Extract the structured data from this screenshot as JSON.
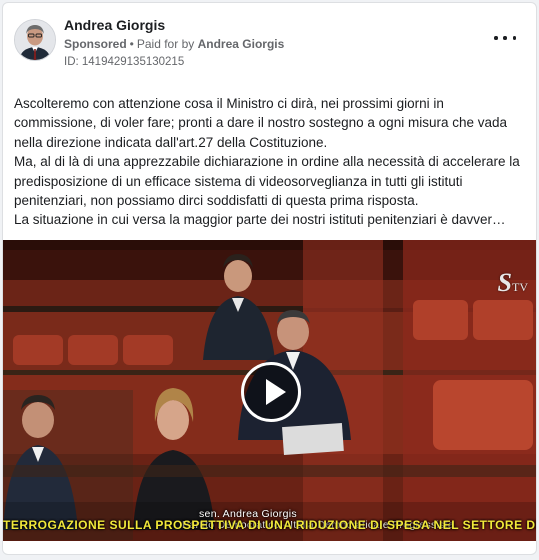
{
  "post": {
    "author": "Andrea Giorgis",
    "sponsored_label": "Sponsored",
    "paid_for_prefix": "Paid for by",
    "paid_for_by": "Andrea Giorgis",
    "ad_id": "ID: 1419429135130215",
    "paragraphs": [
      "Ascolteremo con attenzione cosa il Ministro ci dirà, nei prossimi giorni in commissione, di voler fare; pronti a dare il nostro sostegno a ogni misura che vada nella direzione indicata dall'art.27 della Costituzione.",
      "Ma, al di là di una apprezzabile dichiarazione in ordine alla necessità di accelerare la predisposizione di un efficace sistema di videosorveglianza in tutti gli istituti penitenziari, non possiamo dirci soddisfatti di questa prima risposta.",
      "La situazione in cui versa la maggior parte dei nostri istituti penitenziari è davver…"
    ]
  },
  "video": {
    "channel_logo_letter": "S",
    "channel_logo_suffix": "TV",
    "caption_name": "sen. Andrea Giorgis",
    "caption_party": "Partito Democratico - Italia Democratica e Progressista",
    "ticker": "TERROGAZIONE SULLA PROSPETTIVA DI UNA RIDUZIONE DI SPESA NEL SETTORE DE"
  },
  "icons": {
    "more": "more-horizontal-icon",
    "play": "play-icon"
  },
  "colors": {
    "ticker": "#f2e93a",
    "secondary_text": "#65676b",
    "chamber_red": "#8e2a1c"
  }
}
